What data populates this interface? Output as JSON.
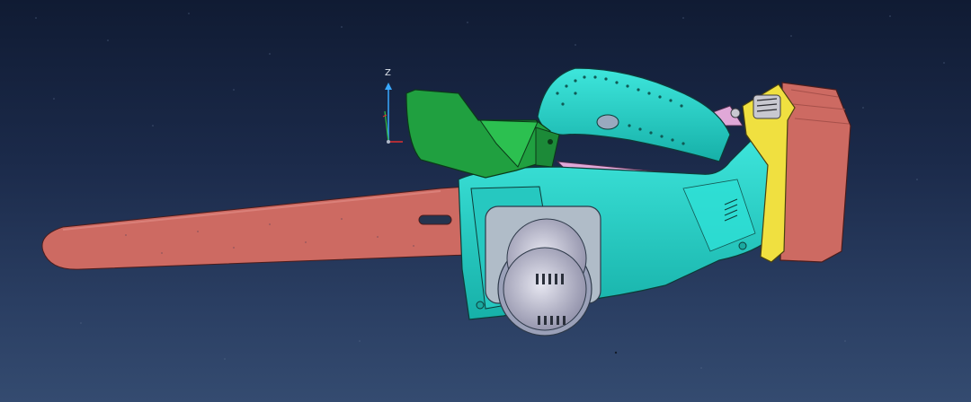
{
  "viewport": {
    "background_top": "#101b33",
    "background_bottom": "#344b70"
  },
  "axis_triad": {
    "z_label": "Z",
    "colors": {
      "x": "#e03030",
      "y": "#30c040",
      "z": "#38a8ff"
    }
  },
  "model": {
    "parts": [
      {
        "name": "guide-bar",
        "color": "#cd6a62"
      },
      {
        "name": "front-hand-guard",
        "color": "#20a040"
      },
      {
        "name": "motor-housing",
        "color": "#22d6cc"
      },
      {
        "name": "motor-cap",
        "color": "#c8c8d8"
      },
      {
        "name": "battery-latch",
        "color": "#f0e040"
      },
      {
        "name": "battery-pack",
        "color": "#cd6a62"
      },
      {
        "name": "inner-trim",
        "color": "#e0a8d8"
      }
    ]
  }
}
